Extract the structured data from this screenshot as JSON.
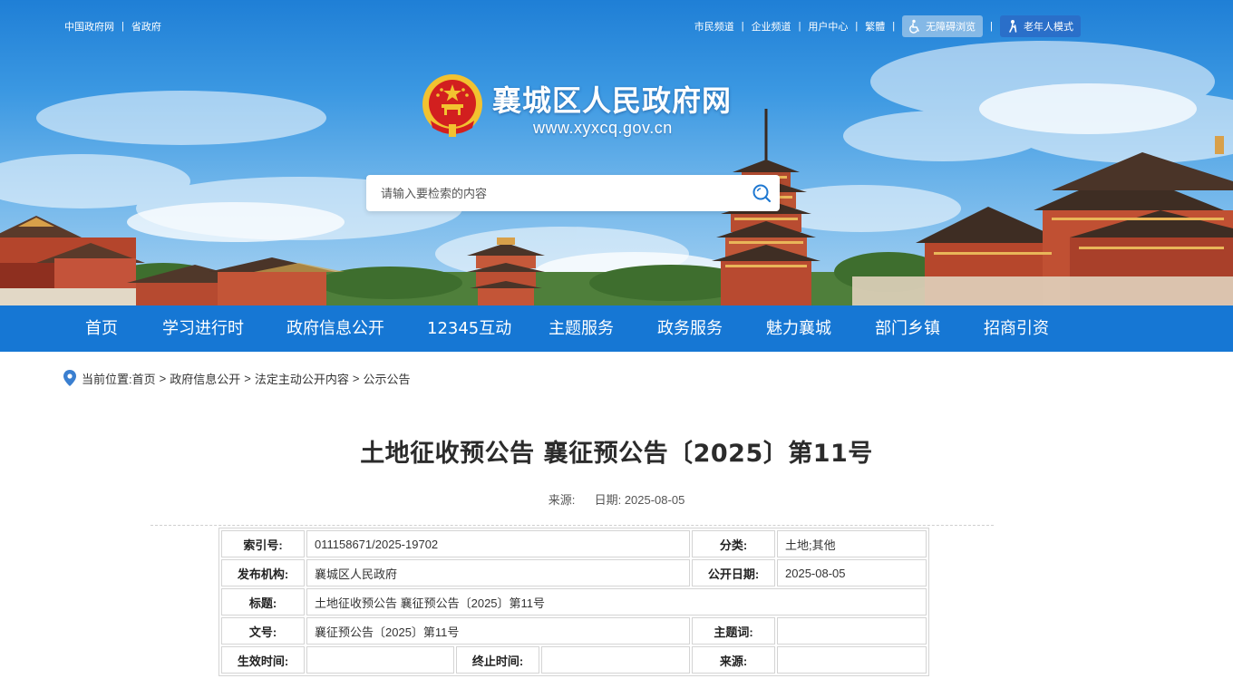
{
  "header": {
    "top_left_links": [
      "中国政府网",
      "省政府"
    ],
    "top_right_links": [
      "市民频道",
      "企业频道",
      "用户中心",
      "繁體"
    ],
    "accessibility_label": "无障碍浏览",
    "elderly_label": "老年人模式",
    "site_name": "襄城区人民政府网",
    "site_url": "www.xyxcq.gov.cn",
    "search_placeholder": "请输入要检索的内容"
  },
  "nav": {
    "items": [
      "首页",
      "学习进行时",
      "政府信息公开",
      "12345互动",
      "主题服务",
      "政务服务",
      "魅力襄城",
      "部门乡镇",
      "招商引资"
    ]
  },
  "breadcrumb": {
    "label": "当前位置:",
    "items": [
      "首页",
      "政府信息公开",
      "法定主动公开内容",
      "公示公告"
    ],
    "separator": ">"
  },
  "article": {
    "title": "土地征收预公告 襄征预公告〔2025〕第11号",
    "source_label": "来源:",
    "date_label": "日期:",
    "date": "2025-08-05"
  },
  "info_table": {
    "index_label": "索引号:",
    "index_value": "011158671/2025-19702",
    "category_label": "分类:",
    "category_value": "土地;其他",
    "publisher_label": "发布机构:",
    "publisher_value": "襄城区人民政府",
    "pubdate_label": "公开日期:",
    "pubdate_value": "2025-08-05",
    "title_label": "标题:",
    "title_value": "土地征收预公告 襄征预公告〔2025〕第11号",
    "docno_label": "文号:",
    "docno_value": "襄征预公告〔2025〕第11号",
    "topic_label": "主题词:",
    "topic_value": "",
    "effective_label": "生效时间:",
    "effective_value": "",
    "end_label": "终止时间:",
    "end_value": "",
    "source_label": "来源:",
    "source_value": ""
  },
  "colors": {
    "nav_bg": "#1677d4",
    "elderly_btn": "#2a6fc9",
    "emblem_red": "#d21f1f",
    "emblem_gold": "#f2c230"
  },
  "icons": [
    "accessibility-icon",
    "elderly-icon",
    "national-emblem-icon",
    "search-icon",
    "location-pin-icon"
  ]
}
